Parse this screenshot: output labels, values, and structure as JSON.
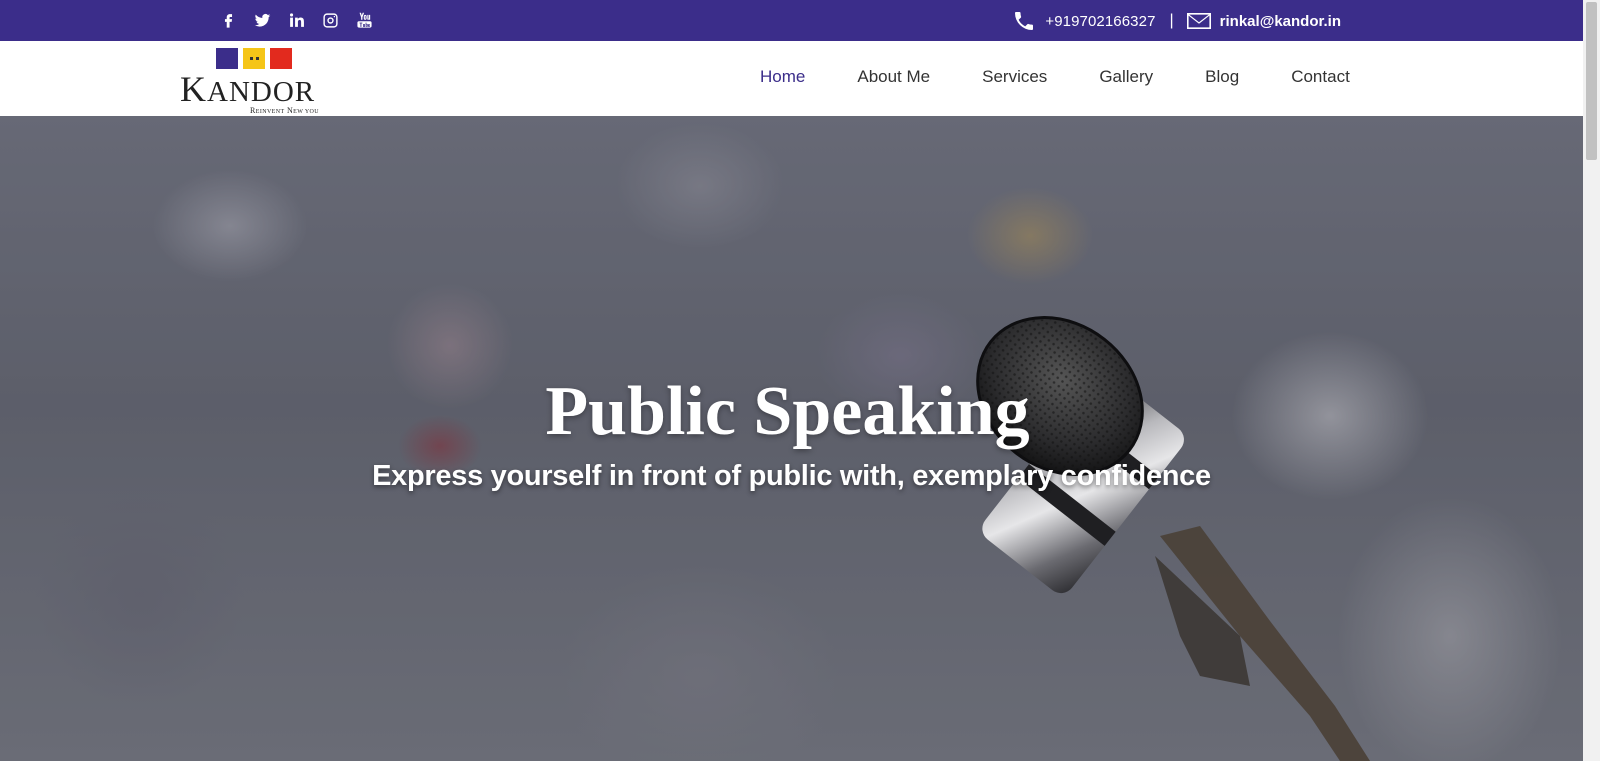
{
  "topbar": {
    "social_icons": [
      "facebook-icon",
      "twitter-icon",
      "linkedin-icon",
      "instagram-icon",
      "youtube-icon"
    ],
    "phone": "+919702166327",
    "separator": "|",
    "email": "rinkal@kandor.in"
  },
  "logo": {
    "brand": "Kandor",
    "tagline": "Reinvent New you"
  },
  "nav": {
    "items": [
      {
        "label": "Home",
        "active": true
      },
      {
        "label": "About Me",
        "active": false
      },
      {
        "label": "Services",
        "active": false
      },
      {
        "label": "Gallery",
        "active": false
      },
      {
        "label": "Blog",
        "active": false
      },
      {
        "label": "Contact",
        "active": false
      }
    ]
  },
  "hero": {
    "title": "Public Speaking",
    "subtitle": "Express yourself in front of public with, exemplary confidence"
  },
  "colors": {
    "brand": "#3b2d8a",
    "yellow": "#f5c518",
    "red": "#e22a1e"
  }
}
